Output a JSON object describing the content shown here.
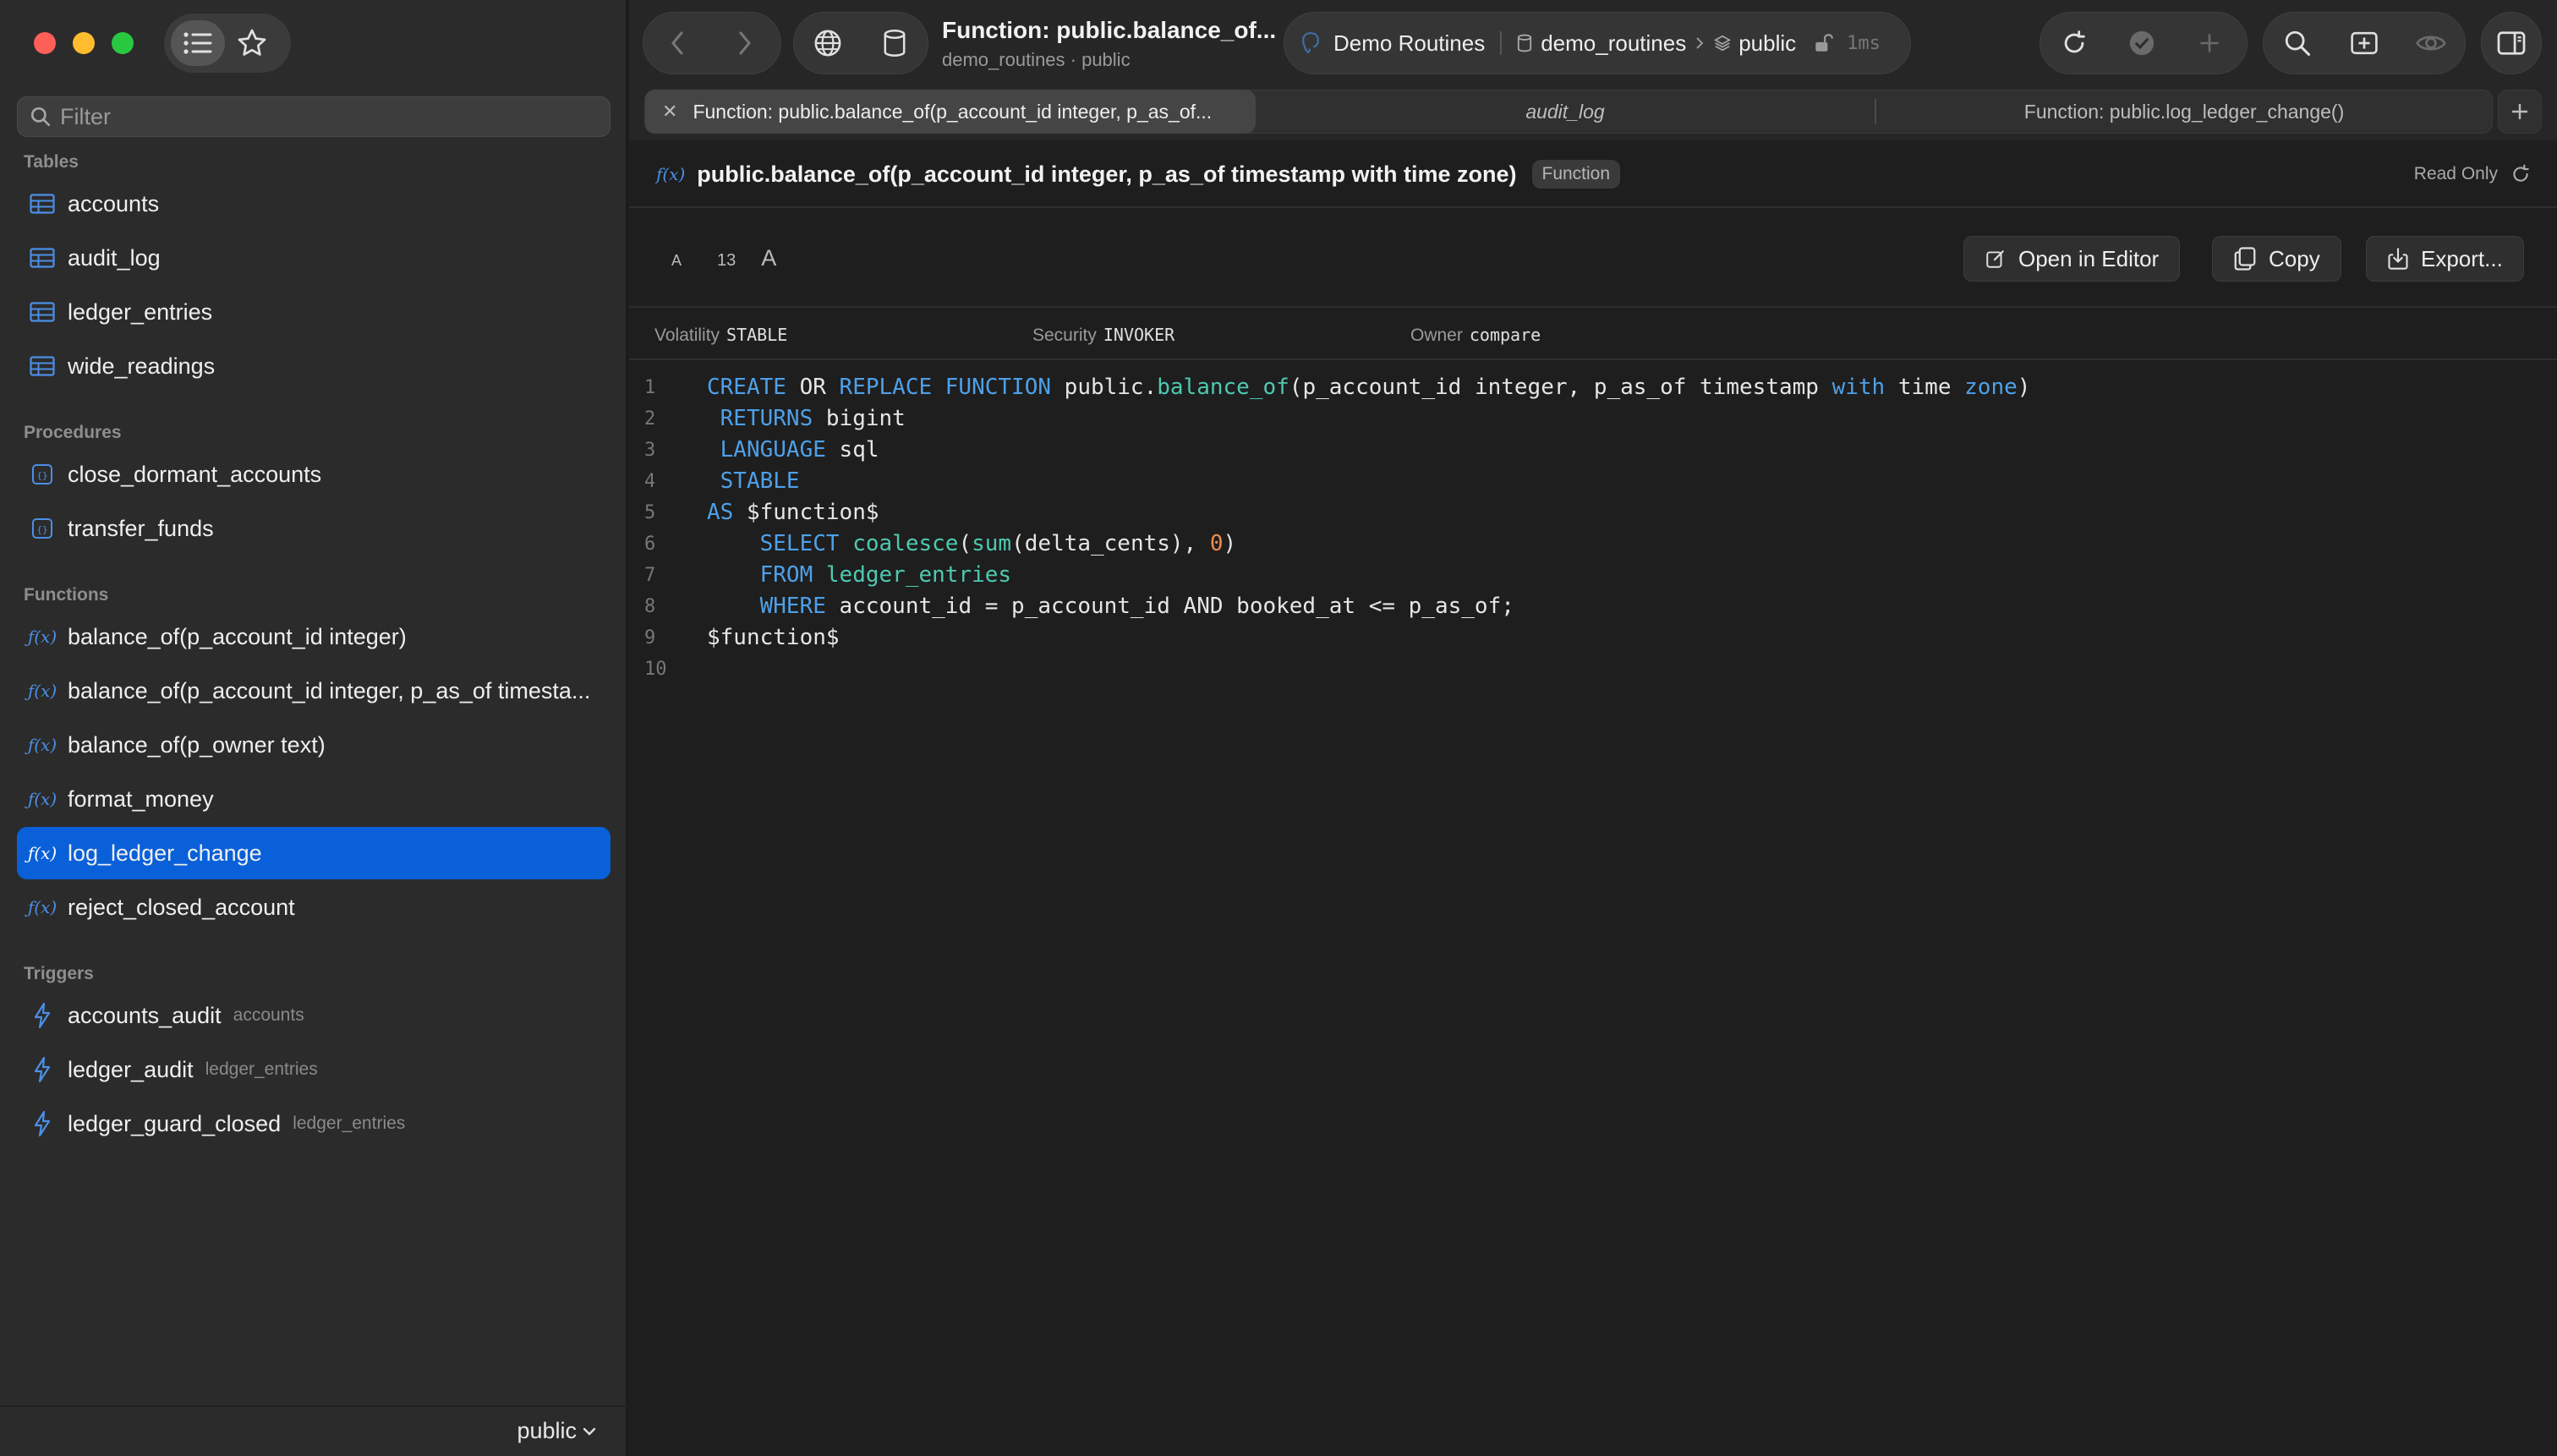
{
  "sidebar": {
    "filter_placeholder": "Filter",
    "sections": {
      "tables": "Tables",
      "procedures": "Procedures",
      "functions": "Functions",
      "triggers": "Triggers"
    },
    "tables": [
      "accounts",
      "audit_log",
      "ledger_entries",
      "wide_readings"
    ],
    "procedures": [
      "close_dormant_accounts",
      "transfer_funds"
    ],
    "functions": [
      "balance_of(p_account_id integer)",
      "balance_of(p_account_id integer, p_as_of timesta...",
      "balance_of(p_owner text)",
      "format_money",
      "log_ledger_change",
      "reject_closed_account"
    ],
    "selected_function": "log_ledger_change",
    "triggers": [
      {
        "name": "accounts_audit",
        "table": "accounts"
      },
      {
        "name": "ledger_audit",
        "table": "ledger_entries"
      },
      {
        "name": "ledger_guard_closed",
        "table": "ledger_entries"
      }
    ],
    "schema": "public"
  },
  "toolbar": {
    "title": "Function: public.balance_of...",
    "subtitle": "demo_routines · public",
    "connection": "Demo Routines",
    "database": "demo_routines",
    "schema": "public",
    "latency": "1ms"
  },
  "tabs": [
    {
      "label": "Function: public.balance_of(p_account_id integer, p_as_of...",
      "active": true
    },
    {
      "label": "audit_log",
      "active": false
    },
    {
      "label": "Function: public.log_ledger_change()",
      "active": false
    }
  ],
  "header": {
    "fx": "f(x)",
    "signature": "public.balance_of(p_account_id integer, p_as_of timestamp with time zone)",
    "badge": "Function",
    "read_only": "Read Only"
  },
  "actions": {
    "font_small": "A",
    "font_size": "13",
    "font_large": "A",
    "open_in_editor": "Open in Editor",
    "copy": "Copy",
    "export": "Export..."
  },
  "meta": {
    "volatility_label": "Volatility",
    "volatility": "STABLE",
    "security_label": "Security",
    "security": "INVOKER",
    "owner_label": "Owner",
    "owner": "compare"
  },
  "code": {
    "line_numbers": [
      "1",
      "2",
      "3",
      "4",
      "5",
      "6",
      "7",
      "8",
      "9",
      "10"
    ],
    "lines": [
      "CREATE OR REPLACE FUNCTION public.balance_of(p_account_id integer, p_as_of timestamp with time zone)",
      " RETURNS bigint",
      " LANGUAGE sql",
      " STABLE",
      "AS $function$",
      "    SELECT coalesce(sum(delta_cents), 0)",
      "    FROM ledger_entries",
      "    WHERE account_id = p_account_id AND booked_at <= p_as_of;",
      "$function$",
      ""
    ]
  },
  "colors": {
    "accent": "#0a60d8",
    "keyword": "#4ea0e8",
    "function": "#4ec9b0",
    "number": "#f08d49"
  }
}
